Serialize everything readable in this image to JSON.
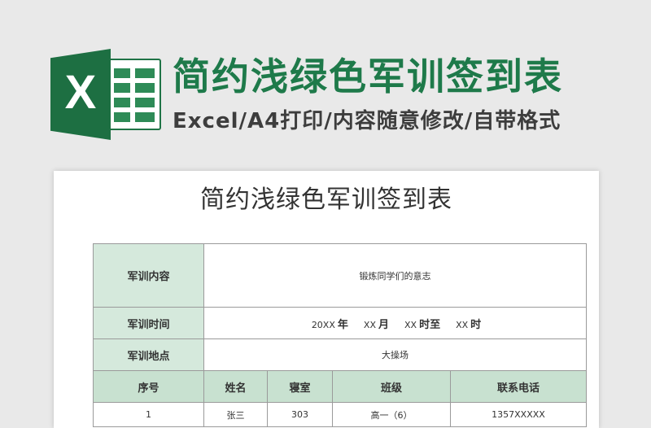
{
  "banner": {
    "title": "简约浅绿色军训签到表",
    "subtitle": "Excel/A4打印/内容随意修改/自带格式",
    "logo_letter": "X"
  },
  "document": {
    "title": "简约浅绿色军训签到表",
    "rows": {
      "content_label": "军训内容",
      "content_value": "锻炼同学们的意志",
      "time_label": "军训时间",
      "time": {
        "year_val": "20XX",
        "year_unit": "年",
        "month_val": "XX",
        "month_unit": "月",
        "hour_val": "XX",
        "hour_unit": "时至",
        "end_val": "XX",
        "end_unit": "时"
      },
      "place_label": "军训地点",
      "place_value": "大操场"
    },
    "columns": [
      "序号",
      "姓名",
      "寝室",
      "班级",
      "联系电话"
    ],
    "entries": [
      {
        "no": "1",
        "name": "张三",
        "room": "303",
        "class": "高一（6）",
        "phone": "1357XXXXX"
      }
    ]
  },
  "colors": {
    "accent": "#1e7a4a",
    "label_bg": "#d5e9dc",
    "header_bg": "#c8e1d0"
  }
}
